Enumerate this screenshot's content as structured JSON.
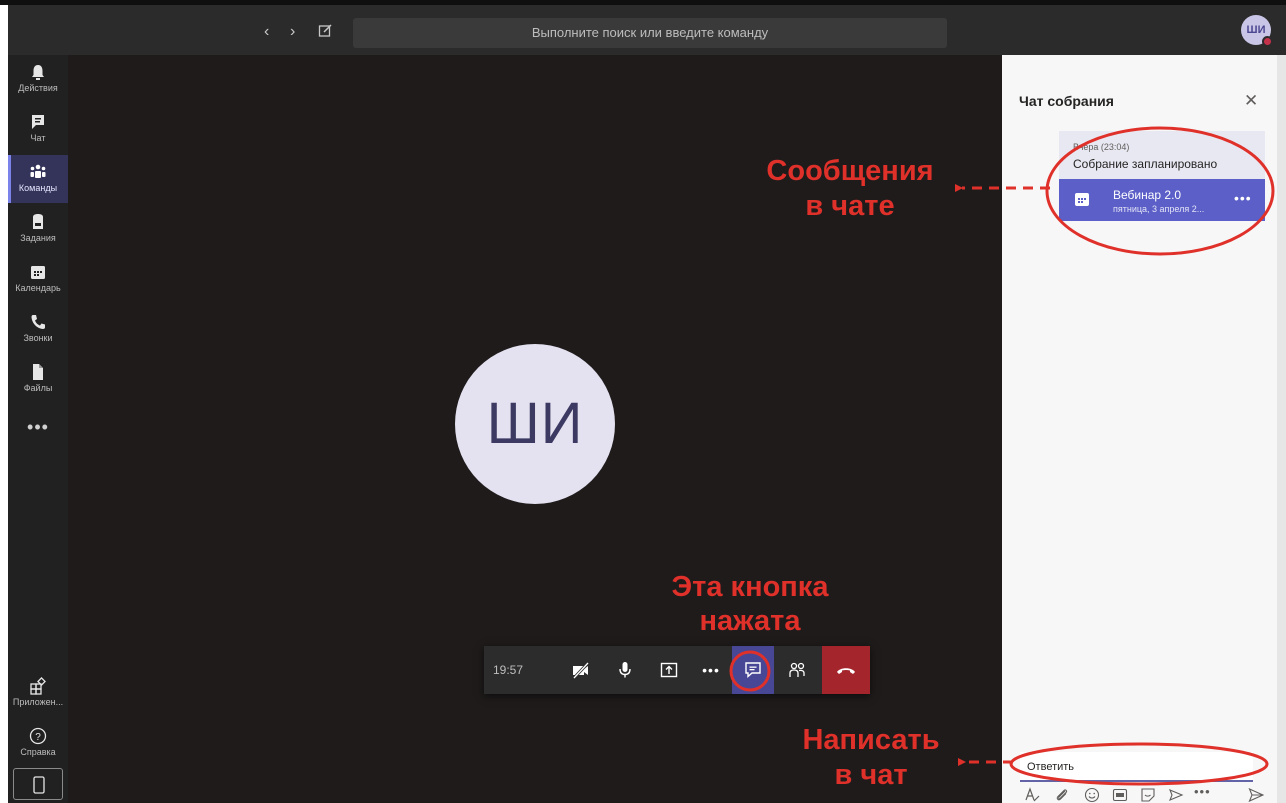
{
  "titlebar": {
    "search_placeholder": "Выполните поиск или введите команду",
    "user_initials": "ШИ"
  },
  "rail": {
    "items": [
      {
        "label": "Действия",
        "icon": "bell-icon"
      },
      {
        "label": "Чат",
        "icon": "chat-icon"
      },
      {
        "label": "Команды",
        "icon": "teams-icon",
        "active": true
      },
      {
        "label": "Задания",
        "icon": "assignments-icon"
      },
      {
        "label": "Календарь",
        "icon": "calendar-icon"
      },
      {
        "label": "Звонки",
        "icon": "phone-icon"
      },
      {
        "label": "Файлы",
        "icon": "file-icon"
      }
    ],
    "more": "•••",
    "apps_label": "Приложен...",
    "help_label": "Справка"
  },
  "meeting": {
    "participant_initials": "ШИ",
    "timer": "19:57",
    "more_label": "•••"
  },
  "chat_panel": {
    "title": "Чат собрания",
    "message_time": "Вчера (23:04)",
    "message_text": "Собрание запланировано",
    "event_title": "Вебинар 2.0",
    "event_date": "пятница, 3 апреля 2...",
    "reply_placeholder": "Ответить",
    "compose_more": "•••"
  },
  "annotations": {
    "messages": [
      "Сообщения",
      "в чате"
    ],
    "button_pressed": [
      "Эта кнопка",
      "нажата"
    ],
    "write": [
      "Написать",
      "в чат"
    ]
  },
  "colors": {
    "accent": "#6264a7",
    "active_chat_button": "#474795",
    "hangup": "#a4262c",
    "annotation_red": "#e0302a"
  }
}
